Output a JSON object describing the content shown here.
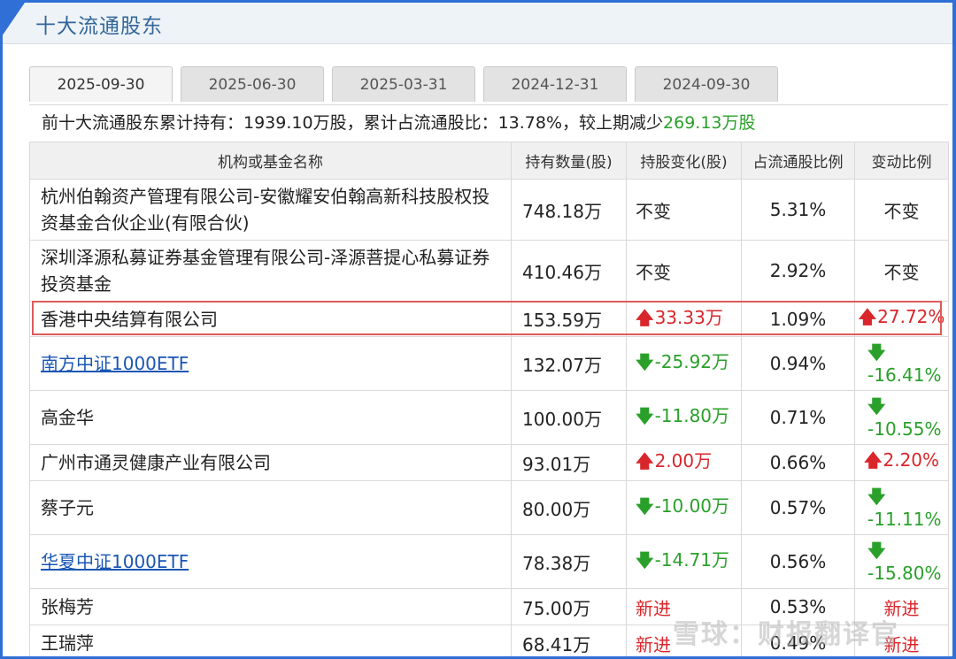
{
  "title": "十大流通股东",
  "tabs": [
    "2025-09-30",
    "2025-06-30",
    "2025-03-31",
    "2024-12-31",
    "2024-09-30"
  ],
  "summary": {
    "prefix": "前十大流通股东累计持有：1939.10万股，累计占流通股比：13.78%，较上期减少",
    "change": "269.13万股"
  },
  "headers": [
    "机构或基金名称",
    "持有数量(股)",
    "持股变化(股)",
    "占流通股比例",
    "变动比例"
  ],
  "rows": [
    {
      "name": "杭州伯翰资产管理有限公司-安徽耀安伯翰高新科技股权投资基金合伙企业(有限合伙)",
      "link": false,
      "qty": "748.18万",
      "change": "不变",
      "dir": "none",
      "pct": "5.31%",
      "ratio": "不变"
    },
    {
      "name": "深圳泽源私募证券基金管理有限公司-泽源菩提心私募证券投资基金",
      "link": false,
      "qty": "410.46万",
      "change": "不变",
      "dir": "none",
      "pct": "2.92%",
      "ratio": "不变"
    },
    {
      "name": "香港中央结算有限公司",
      "link": false,
      "qty": "153.59万",
      "change": "33.33万",
      "dir": "up",
      "pct": "1.09%",
      "ratio": "27.72%"
    },
    {
      "name": "南方中证1000ETF",
      "link": true,
      "qty": "132.07万",
      "change": "-25.92万",
      "dir": "down",
      "pct": "0.94%",
      "ratio": "-16.41%"
    },
    {
      "name": "高金华",
      "link": false,
      "qty": "100.00万",
      "change": "-11.80万",
      "dir": "down",
      "pct": "0.71%",
      "ratio": "-10.55%"
    },
    {
      "name": "广州市通灵健康产业有限公司",
      "link": false,
      "qty": "93.01万",
      "change": "2.00万",
      "dir": "up",
      "pct": "0.66%",
      "ratio": "2.20%"
    },
    {
      "name": "蔡子元",
      "link": false,
      "qty": "80.00万",
      "change": "-10.00万",
      "dir": "down",
      "pct": "0.57%",
      "ratio": "-11.11%"
    },
    {
      "name": "华夏中证1000ETF",
      "link": true,
      "qty": "78.38万",
      "change": "-14.71万",
      "dir": "down",
      "pct": "0.56%",
      "ratio": "-15.80%"
    },
    {
      "name": "张梅芳",
      "link": false,
      "qty": "75.00万",
      "change": "新进",
      "dir": "new",
      "pct": "0.53%",
      "ratio": "新进"
    },
    {
      "name": "王瑞萍",
      "link": false,
      "qty": "68.41万",
      "change": "新进",
      "dir": "new",
      "pct": "0.49%",
      "ratio": "新进"
    }
  ],
  "watermark": "雪球：财报翻译官",
  "colors": {
    "accent": "#2f6fd6",
    "up": "#d9262b",
    "down": "#2aa02a",
    "link": "#1a56b4"
  }
}
